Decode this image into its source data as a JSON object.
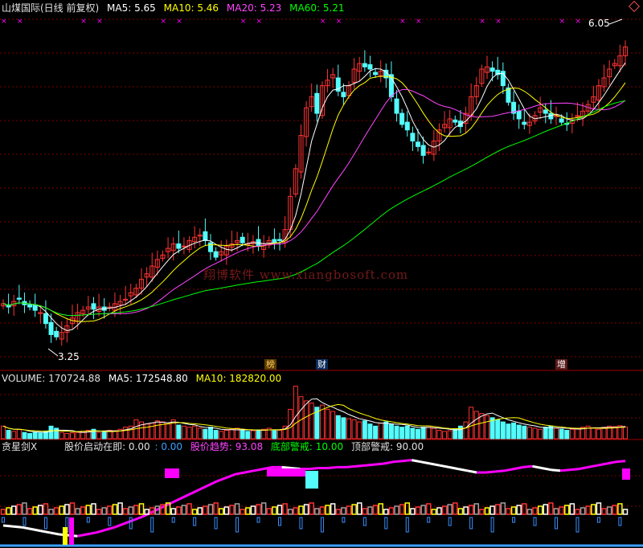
{
  "price_header": {
    "title": "山煤国际(日线 前复权)",
    "ma5": "MA5: 5.65",
    "ma10": "MA10: 5.46",
    "ma20": "MA20: 5.23",
    "ma60": "MA60: 5.21"
  },
  "volume_header": {
    "vol": "VOLUME: 170724.88",
    "ma5": "MA5: 172548.80",
    "ma10": "MA10: 182820.00"
  },
  "indicator_header": {
    "name": "贪星剑X",
    "start": "股价启动在即: 0.00",
    "start2": ": 0.00",
    "trend": "股价趋势: 93.08",
    "bottom": "底部警戒: 10.00",
    "top": "顶部警戒: 90.00"
  },
  "annotations": {
    "high_label": "6.05",
    "low_label": "3.25",
    "tag_bang": "榜",
    "tag_cai": "财",
    "tag_zeng": "增"
  },
  "watermark": "翔博软件 www.xiangbosoft.com",
  "colors": {
    "up": "#ff3333",
    "down": "#54fcfc",
    "ma5": "#ffffff",
    "ma10": "#ffff00",
    "ma20": "#ff44ff",
    "ma60": "#00ff00",
    "grid": "#800000",
    "magenta": "#ff00ff",
    "white_label": "#ffffff",
    "label_yellow": "#ffff00"
  },
  "chart_data": [
    {
      "type": "candlestick",
      "title": "山煤国际(日线 前复权)",
      "annotated_high": 6.05,
      "annotated_low": 3.25,
      "ylim": [
        3.1,
        6.15
      ],
      "closes": [
        3.58,
        3.55,
        3.6,
        3.62,
        3.57,
        3.55,
        3.52,
        3.5,
        3.4,
        3.3,
        3.28,
        3.32,
        3.38,
        3.45,
        3.5,
        3.52,
        3.55,
        3.53,
        3.55,
        3.52,
        3.55,
        3.58,
        3.6,
        3.62,
        3.68,
        3.72,
        3.8,
        3.85,
        3.92,
        3.98,
        4.02,
        4.08,
        4.12,
        4.08,
        4.1,
        4.15,
        4.18,
        4.2,
        4.15,
        4.05,
        4.0,
        4.05,
        4.1,
        4.12,
        4.15,
        4.13,
        4.12,
        4.14,
        4.1,
        4.12,
        4.15,
        4.13,
        4.15,
        4.25,
        4.55,
        4.8,
        5.1,
        5.35,
        5.45,
        5.3,
        5.55,
        5.6,
        5.65,
        5.5,
        5.45,
        5.55,
        5.7,
        5.75,
        5.72,
        5.7,
        5.65,
        5.68,
        5.62,
        5.45,
        5.3,
        5.2,
        5.15,
        5.05,
        5.0,
        4.92,
        4.95,
        5.05,
        5.15,
        5.2,
        5.25,
        5.22,
        5.18,
        5.3,
        5.45,
        5.55,
        5.7,
        5.72,
        5.68,
        5.65,
        5.55,
        5.4,
        5.3,
        5.25,
        5.2,
        5.22,
        5.28,
        5.35,
        5.3,
        5.25,
        5.28,
        5.22,
        5.2,
        5.24,
        5.28,
        5.32,
        5.38,
        5.45,
        5.55,
        5.62,
        5.7,
        5.75,
        5.82,
        5.9
      ]
    },
    {
      "type": "bar",
      "title": "VOLUME",
      "ylim": [
        0,
        260000
      ],
      "values": [
        60,
        40,
        35,
        45,
        30,
        25,
        30,
        28,
        35,
        60,
        50,
        30,
        25,
        28,
        30,
        35,
        40,
        45,
        30,
        35,
        40,
        38,
        45,
        55,
        60,
        90,
        80,
        70,
        75,
        85,
        80,
        70,
        90,
        65,
        60,
        55,
        60,
        50,
        45,
        55,
        40,
        35,
        40,
        45,
        50,
        40,
        35,
        38,
        42,
        45,
        50,
        38,
        40,
        60,
        140,
        250,
        200,
        180,
        170,
        150,
        160,
        140,
        130,
        110,
        100,
        95,
        90,
        80,
        85,
        70,
        60,
        75,
        80,
        70,
        60,
        55,
        60,
        50,
        45,
        55,
        60,
        50,
        40,
        35,
        38,
        45,
        60,
        80,
        150,
        130,
        120,
        110,
        100,
        90,
        80,
        70,
        75,
        65,
        60,
        55,
        50,
        45,
        55,
        60,
        50,
        45,
        40,
        45,
        50,
        55,
        60,
        50,
        45,
        55,
        60,
        58,
        62,
        56
      ]
    },
    {
      "type": "line",
      "title": "贪星剑X",
      "ylim": [
        0,
        100
      ],
      "trend": [
        20,
        19,
        18,
        16,
        14,
        12,
        10,
        9,
        8,
        10,
        12,
        15,
        18,
        22,
        26,
        30,
        35,
        40,
        45,
        50,
        55,
        60,
        65,
        70,
        74,
        78,
        80,
        82,
        84,
        86,
        86,
        85,
        84,
        84,
        85,
        85,
        86,
        86,
        87,
        88,
        89,
        90,
        92,
        93,
        94,
        92,
        90,
        88,
        86,
        84,
        82,
        80,
        80,
        81,
        82,
        84,
        86,
        87,
        85,
        83,
        82,
        83,
        84,
        86,
        88,
        90,
        92,
        93
      ]
    }
  ]
}
